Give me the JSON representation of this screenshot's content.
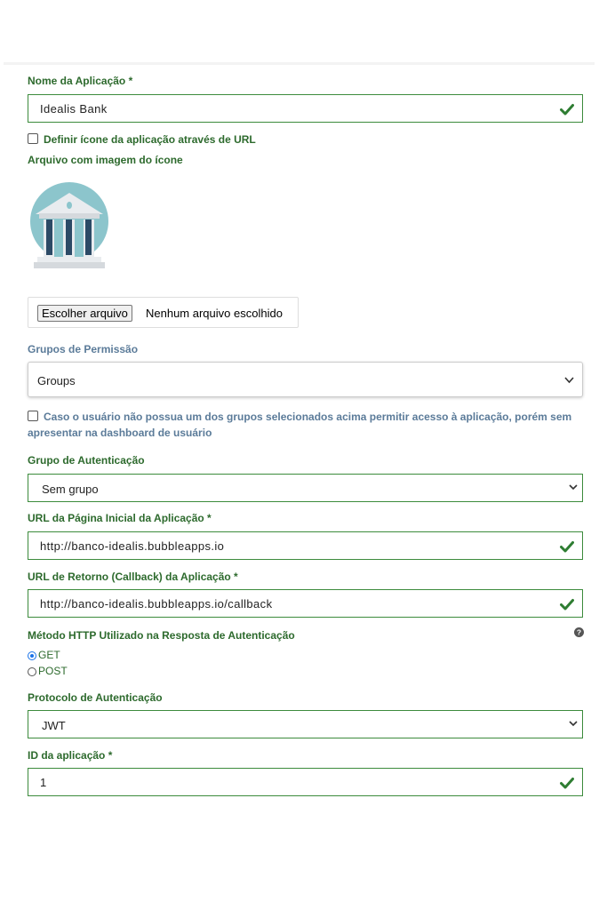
{
  "app_name": {
    "label": "Nome da Aplicação *",
    "value": "Idealis Bank"
  },
  "icon_url_checkbox": {
    "label": "Definir ícone da aplicação através de URL"
  },
  "icon_file": {
    "label": "Arquivo com imagem do ícone",
    "choose_button": "Escolher arquivo",
    "no_file_text": "Nenhum arquivo escolhido"
  },
  "permission_groups": {
    "label": "Grupos de Permissão",
    "selected": "Groups",
    "checkbox_label": "Caso o usuário não possua um dos grupos selecionados acima permitir acesso à aplicação, porém sem apresentar na dashboard de usuário"
  },
  "auth_group": {
    "label": "Grupo de Autenticação",
    "selected": "Sem grupo"
  },
  "home_url": {
    "label": "URL da Página Inicial da Aplicação *",
    "value": "http://banco-idealis.bubbleapps.io"
  },
  "callback_url": {
    "label": "URL de Retorno (Callback) da Aplicação *",
    "value": "http://banco-idealis.bubbleapps.io/callback"
  },
  "http_method": {
    "label": "Método HTTP Utilizado na Resposta de Autenticação",
    "options": [
      "GET",
      "POST"
    ],
    "selected": "GET"
  },
  "auth_protocol": {
    "label": "Protocolo de Autenticação",
    "selected": "JWT"
  },
  "app_id": {
    "label": "ID da aplicação *",
    "value": "1"
  },
  "colors": {
    "label_green": "#2d6a2d",
    "label_blue": "#5b7b99",
    "border_green": "#3c8b3c",
    "icon_teal": "#8cc5cc"
  },
  "icons": {
    "valid": "check-icon",
    "help": "question-icon",
    "dropdown": "chevron-down-icon",
    "app_icon": "bank-building-icon"
  }
}
